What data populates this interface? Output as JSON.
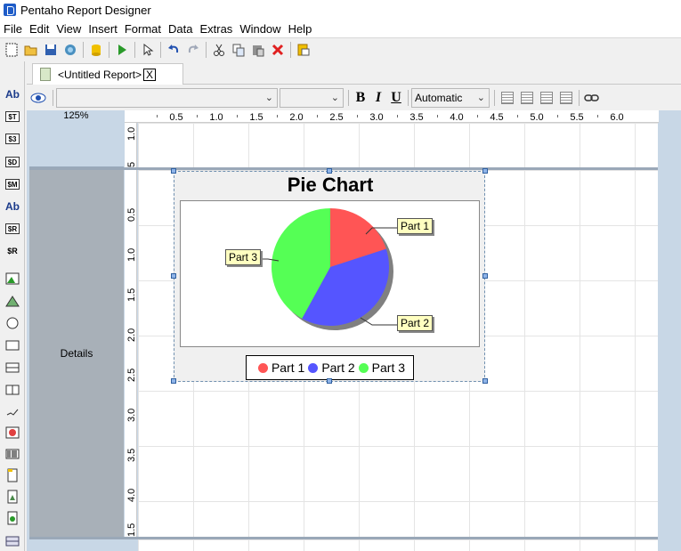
{
  "window": {
    "title": "Pentaho Report Designer"
  },
  "menu": [
    "File",
    "Edit",
    "View",
    "Insert",
    "Format",
    "Data",
    "Extras",
    "Window",
    "Help"
  ],
  "toolbar": {
    "icons": [
      "new-report-icon",
      "open-icon",
      "save-icon",
      "publish-icon",
      "datasource-icon",
      "run-icon",
      "select-icon",
      "undo-icon",
      "redo-icon",
      "cut-icon",
      "copy-icon",
      "paste-icon",
      "delete-icon",
      "preview-icon"
    ]
  },
  "tab": {
    "label": "<Untitled Report>",
    "close": "X"
  },
  "format_bar": {
    "font_family": "",
    "font_size": "",
    "bold": "B",
    "italic": "I",
    "underline": "U",
    "color": "Automatic"
  },
  "left_palette": {
    "items": [
      {
        "name": "label-icon",
        "text": "Ab"
      },
      {
        "name": "text-field-icon",
        "text": "$T"
      },
      {
        "name": "number-field-icon",
        "text": "$3"
      },
      {
        "name": "date-field-icon",
        "text": "$D"
      },
      {
        "name": "message-field-icon",
        "text": "$M"
      },
      {
        "name": "resource-label-icon",
        "text": "Ab"
      },
      {
        "name": "resource-field-icon",
        "text": "$R"
      },
      {
        "name": "resource-message-icon",
        "text": "$R"
      },
      {
        "name": "image-icon",
        "text": ""
      },
      {
        "name": "image-field-icon",
        "text": ""
      },
      {
        "name": "ellipse-icon",
        "text": ""
      },
      {
        "name": "rectangle-icon",
        "text": ""
      },
      {
        "name": "horizontal-line-icon",
        "text": ""
      },
      {
        "name": "vertical-line-icon",
        "text": ""
      },
      {
        "name": "survey-scale-icon",
        "text": ""
      },
      {
        "name": "chart-icon",
        "text": ""
      },
      {
        "name": "barcode-icon",
        "text": ""
      },
      {
        "name": "band-icon",
        "text": ""
      },
      {
        "name": "subreport-icon",
        "text": ""
      },
      {
        "name": "table-of-contents-icon",
        "text": ""
      },
      {
        "name": "index-icon",
        "text": ""
      }
    ]
  },
  "canvas": {
    "zoom": "125%",
    "h_ruler": [
      "0.5",
      "1.0",
      "1.5",
      "2.0",
      "2.5",
      "3.0",
      "3.5",
      "4.0",
      "4.5",
      "5.0",
      "5.5",
      "6.0"
    ],
    "header_ruler": [
      "1.0",
      "5"
    ],
    "details_ruler": [
      "0.5",
      "1.0",
      "1.5",
      "2.0",
      "2.5",
      "3.0",
      "3.5",
      "4.0",
      "1.5"
    ],
    "details_band_label": "Details"
  },
  "chart_data": {
    "type": "pie",
    "title": "Pie Chart",
    "categories": [
      "Part 1",
      "Part 2",
      "Part 3"
    ],
    "values": [
      20,
      38,
      42
    ],
    "colors": [
      "#ff5555",
      "#5555ff",
      "#55ff55"
    ],
    "legend_position": "bottom"
  }
}
